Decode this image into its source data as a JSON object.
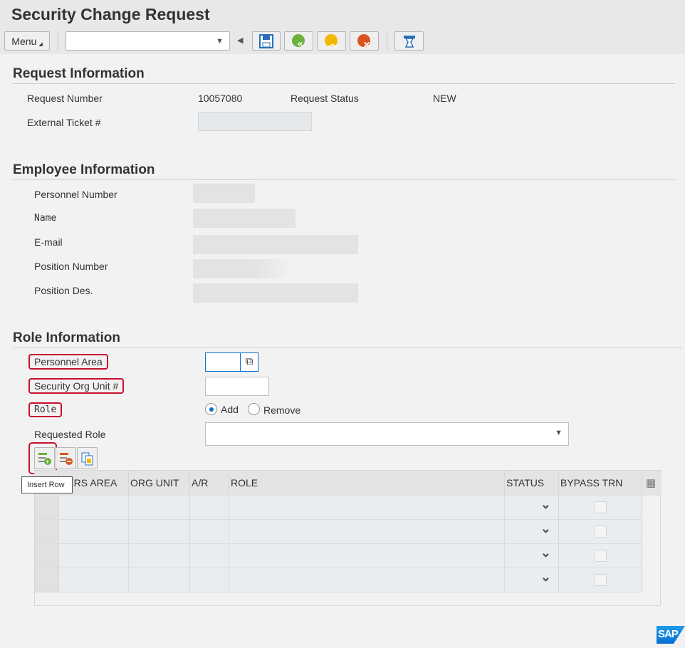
{
  "title": "Security Change Request",
  "toolbar": {
    "menu_label": "Menu",
    "command_value": "",
    "icons": [
      "save-icon",
      "back-icon",
      "exit-icon",
      "cancel-icon",
      "print-icon"
    ]
  },
  "request": {
    "heading": "Request Information",
    "number_label": "Request Number",
    "number_value": "10057080",
    "status_label": "Request Status",
    "status_value": "NEW",
    "ticket_label": "External Ticket #",
    "ticket_value": ""
  },
  "employee": {
    "heading": "Employee Information",
    "fields": [
      {
        "label": "Personnel Number"
      },
      {
        "label": "Name"
      },
      {
        "label": "E-mail"
      },
      {
        "label": "Position Number"
      },
      {
        "label": "Position Des."
      }
    ]
  },
  "role": {
    "heading": "Role Information",
    "pers_area_label": "Personnel Area",
    "org_unit_label": "Security Org Unit #",
    "role_label": "Role",
    "add_label": "Add",
    "remove_label": "Remove",
    "selected_action": "Add",
    "requested_role_label": "Requested Role",
    "requested_role_value": ""
  },
  "table": {
    "tooltip": "Insert Row",
    "columns": [
      "PERS AREA",
      "ORG UNIT",
      "A/R",
      "ROLE",
      "STATUS",
      "BYPASS TRN"
    ],
    "rows": [
      {},
      {},
      {},
      {}
    ]
  },
  "brand": {
    "accent": "#0a6ed1",
    "highlight": "#c8102e"
  }
}
